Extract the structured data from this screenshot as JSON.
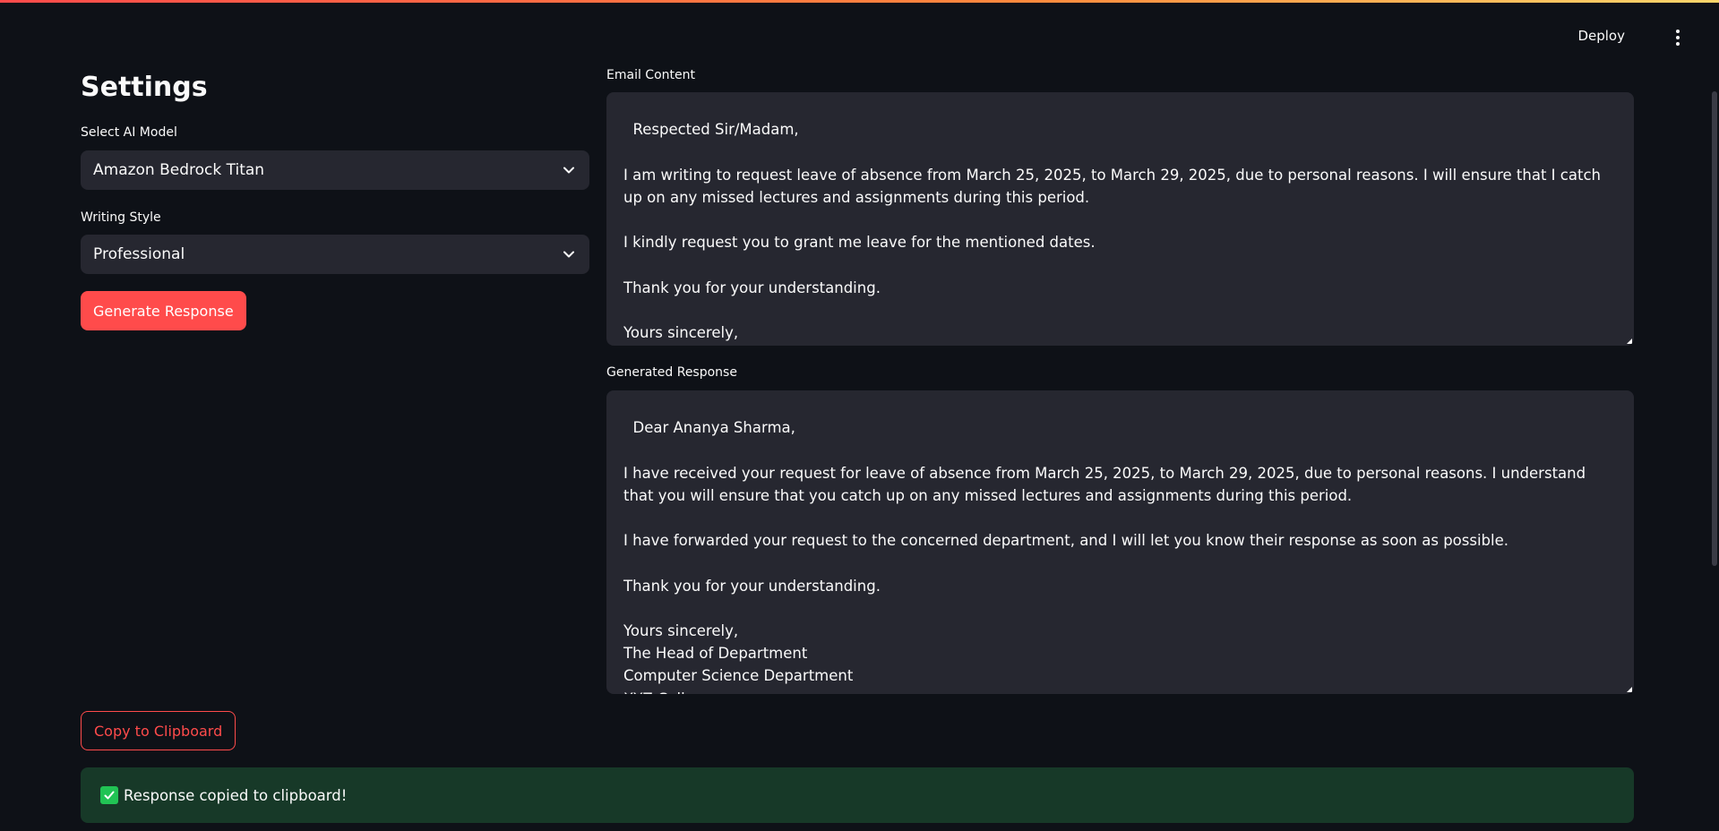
{
  "header": {
    "deploy_label": "Deploy",
    "menu_icon": "vertical-dots-icon"
  },
  "settings": {
    "title": "Settings",
    "model_label": "Select AI Model",
    "model_value": "Amazon Bedrock Titan",
    "style_label": "Writing Style",
    "style_value": "Professional",
    "generate_label": "Generate Response"
  },
  "email": {
    "label": "Email Content",
    "content": "Respected Sir/Madam,\n\nI am writing to request leave of absence from March 25, 2025, to March 29, 2025, due to personal reasons. I will ensure that I catch up on any missed lectures and assignments during this period.\n\nI kindly request you to grant me leave for the mentioned dates.\n\nThank you for your understanding.\n\nYours sincerely,\nAnanya Sharma"
  },
  "response": {
    "label": "Generated Response",
    "content": "Dear Ananya Sharma,\n\nI have received your request for leave of absence from March 25, 2025, to March 29, 2025, due to personal reasons. I understand that you will ensure that you catch up on any missed lectures and assignments during this period.\n\nI have forwarded your request to the concerned department, and I will let you know their response as soon as possible.\n\nThank you for your understanding.\n\nYours sincerely,\nThe Head of Department\nComputer Science Department\nXYZ College"
  },
  "actions": {
    "copy_label": "Copy to Clipboard",
    "success_message": "Response copied to clipboard!"
  },
  "colors": {
    "background": "#0e1117",
    "input_bg": "#262730",
    "primary": "#ff4b4b",
    "success_bg": "#173928",
    "success_icon": "#21c354"
  }
}
